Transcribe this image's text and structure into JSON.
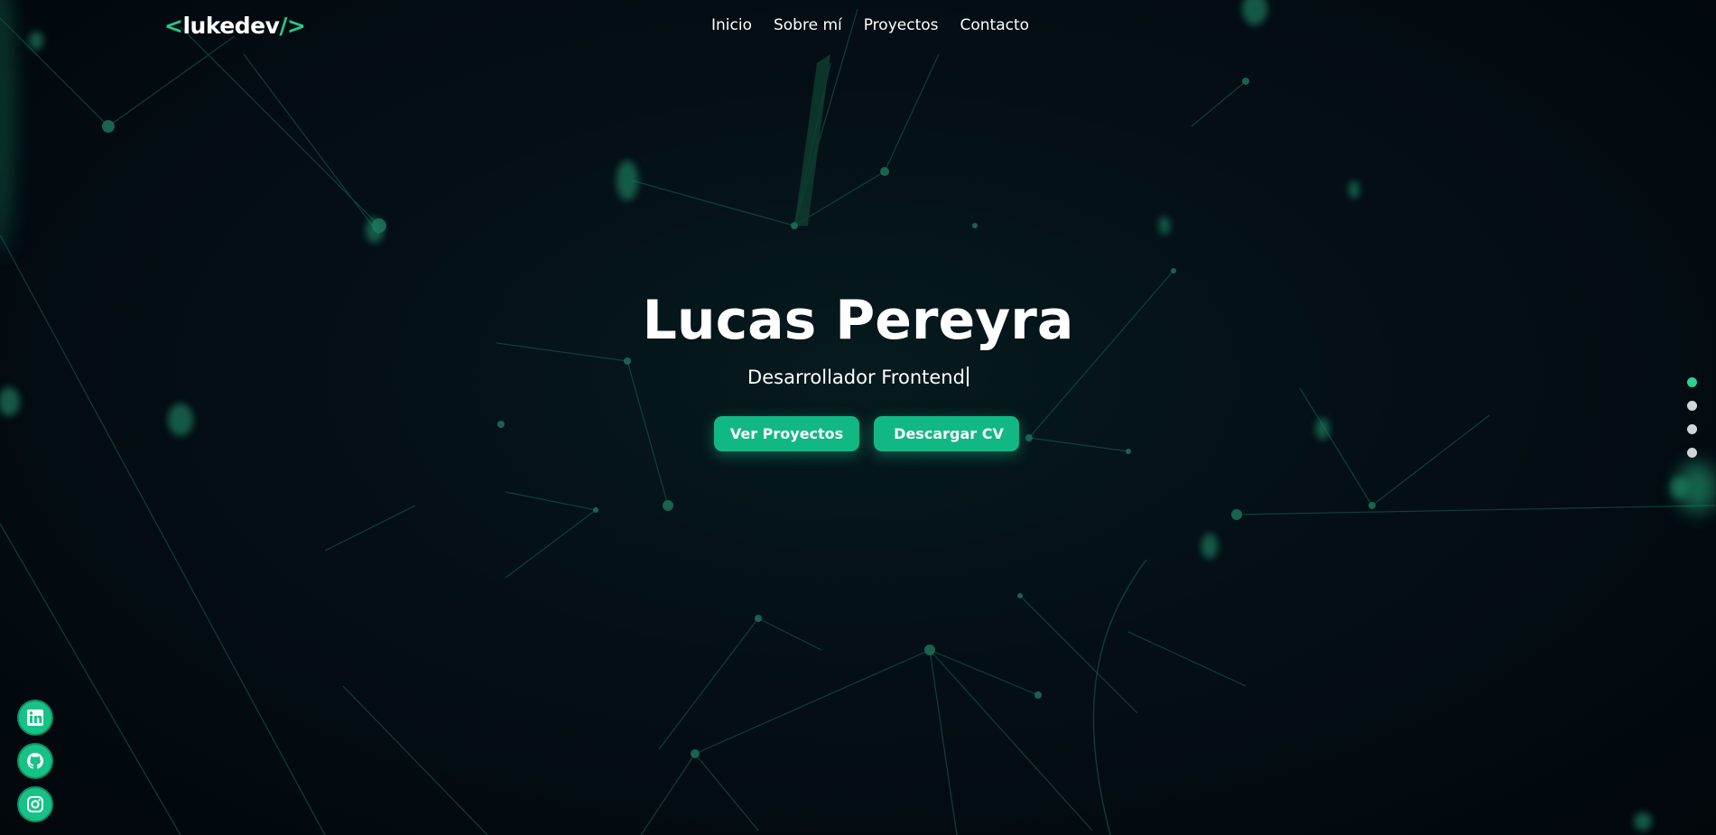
{
  "brand": {
    "open_bracket": "<",
    "name": "lukedev",
    "close_bracket": "/>",
    "accent_color": "#1fcc8f"
  },
  "nav": {
    "items": [
      {
        "label": "Inicio"
      },
      {
        "label": "Sobre mí"
      },
      {
        "label": "Proyectos"
      },
      {
        "label": "Contacto"
      }
    ]
  },
  "hero": {
    "title": "Lucas Pereyra",
    "subtitle": "Desarrollador Frontend",
    "buttons": {
      "projects_label": "Ver Proyectos",
      "cv_label": "Descargar CV",
      "cv_icon": "download-icon",
      "color": "#12b883"
    }
  },
  "section_indicator": {
    "count": 4,
    "active_index": 0,
    "active_color": "#2ecf94",
    "inactive_color": "#cfd6d8"
  },
  "social": {
    "links": [
      {
        "icon": "linkedin-icon"
      },
      {
        "icon": "github-icon"
      },
      {
        "icon": "instagram-icon"
      }
    ],
    "color": "#17c287"
  }
}
